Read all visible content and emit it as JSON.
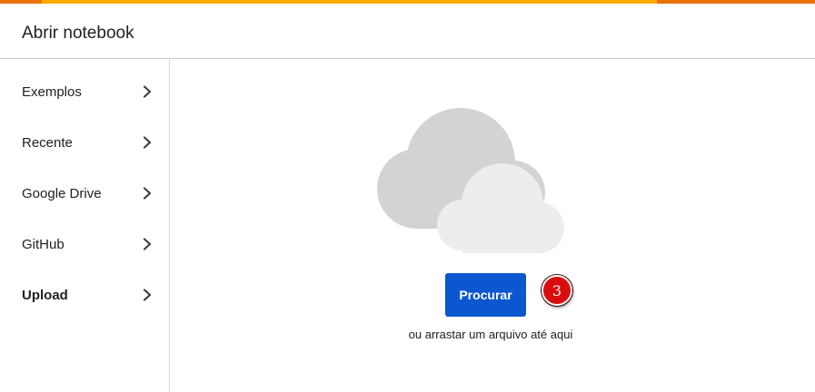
{
  "dialog": {
    "title": "Abrir notebook"
  },
  "sidebar": {
    "items": [
      {
        "label": "Exemplos",
        "active": false,
        "icon": "chevron-right-icon"
      },
      {
        "label": "Recente",
        "active": false,
        "icon": "chevron-right-icon"
      },
      {
        "label": "Google Drive",
        "active": false,
        "icon": "chevron-right-icon"
      },
      {
        "label": "GitHub",
        "active": false,
        "icon": "chevron-right-icon"
      },
      {
        "label": "Upload",
        "active": true,
        "icon": "chevron-right-icon"
      }
    ]
  },
  "upload": {
    "illustration_icon": "cloud-upload-icon",
    "browse_label": "Procurar",
    "drop_hint": "ou arrastar um arquivo até aqui",
    "step_marker": "3"
  },
  "colors": {
    "accent_orange": "#e8710a",
    "accent_yellow": "#f9ab00",
    "primary_button": "#0b57d0",
    "step_marker": "#d90d0d"
  }
}
